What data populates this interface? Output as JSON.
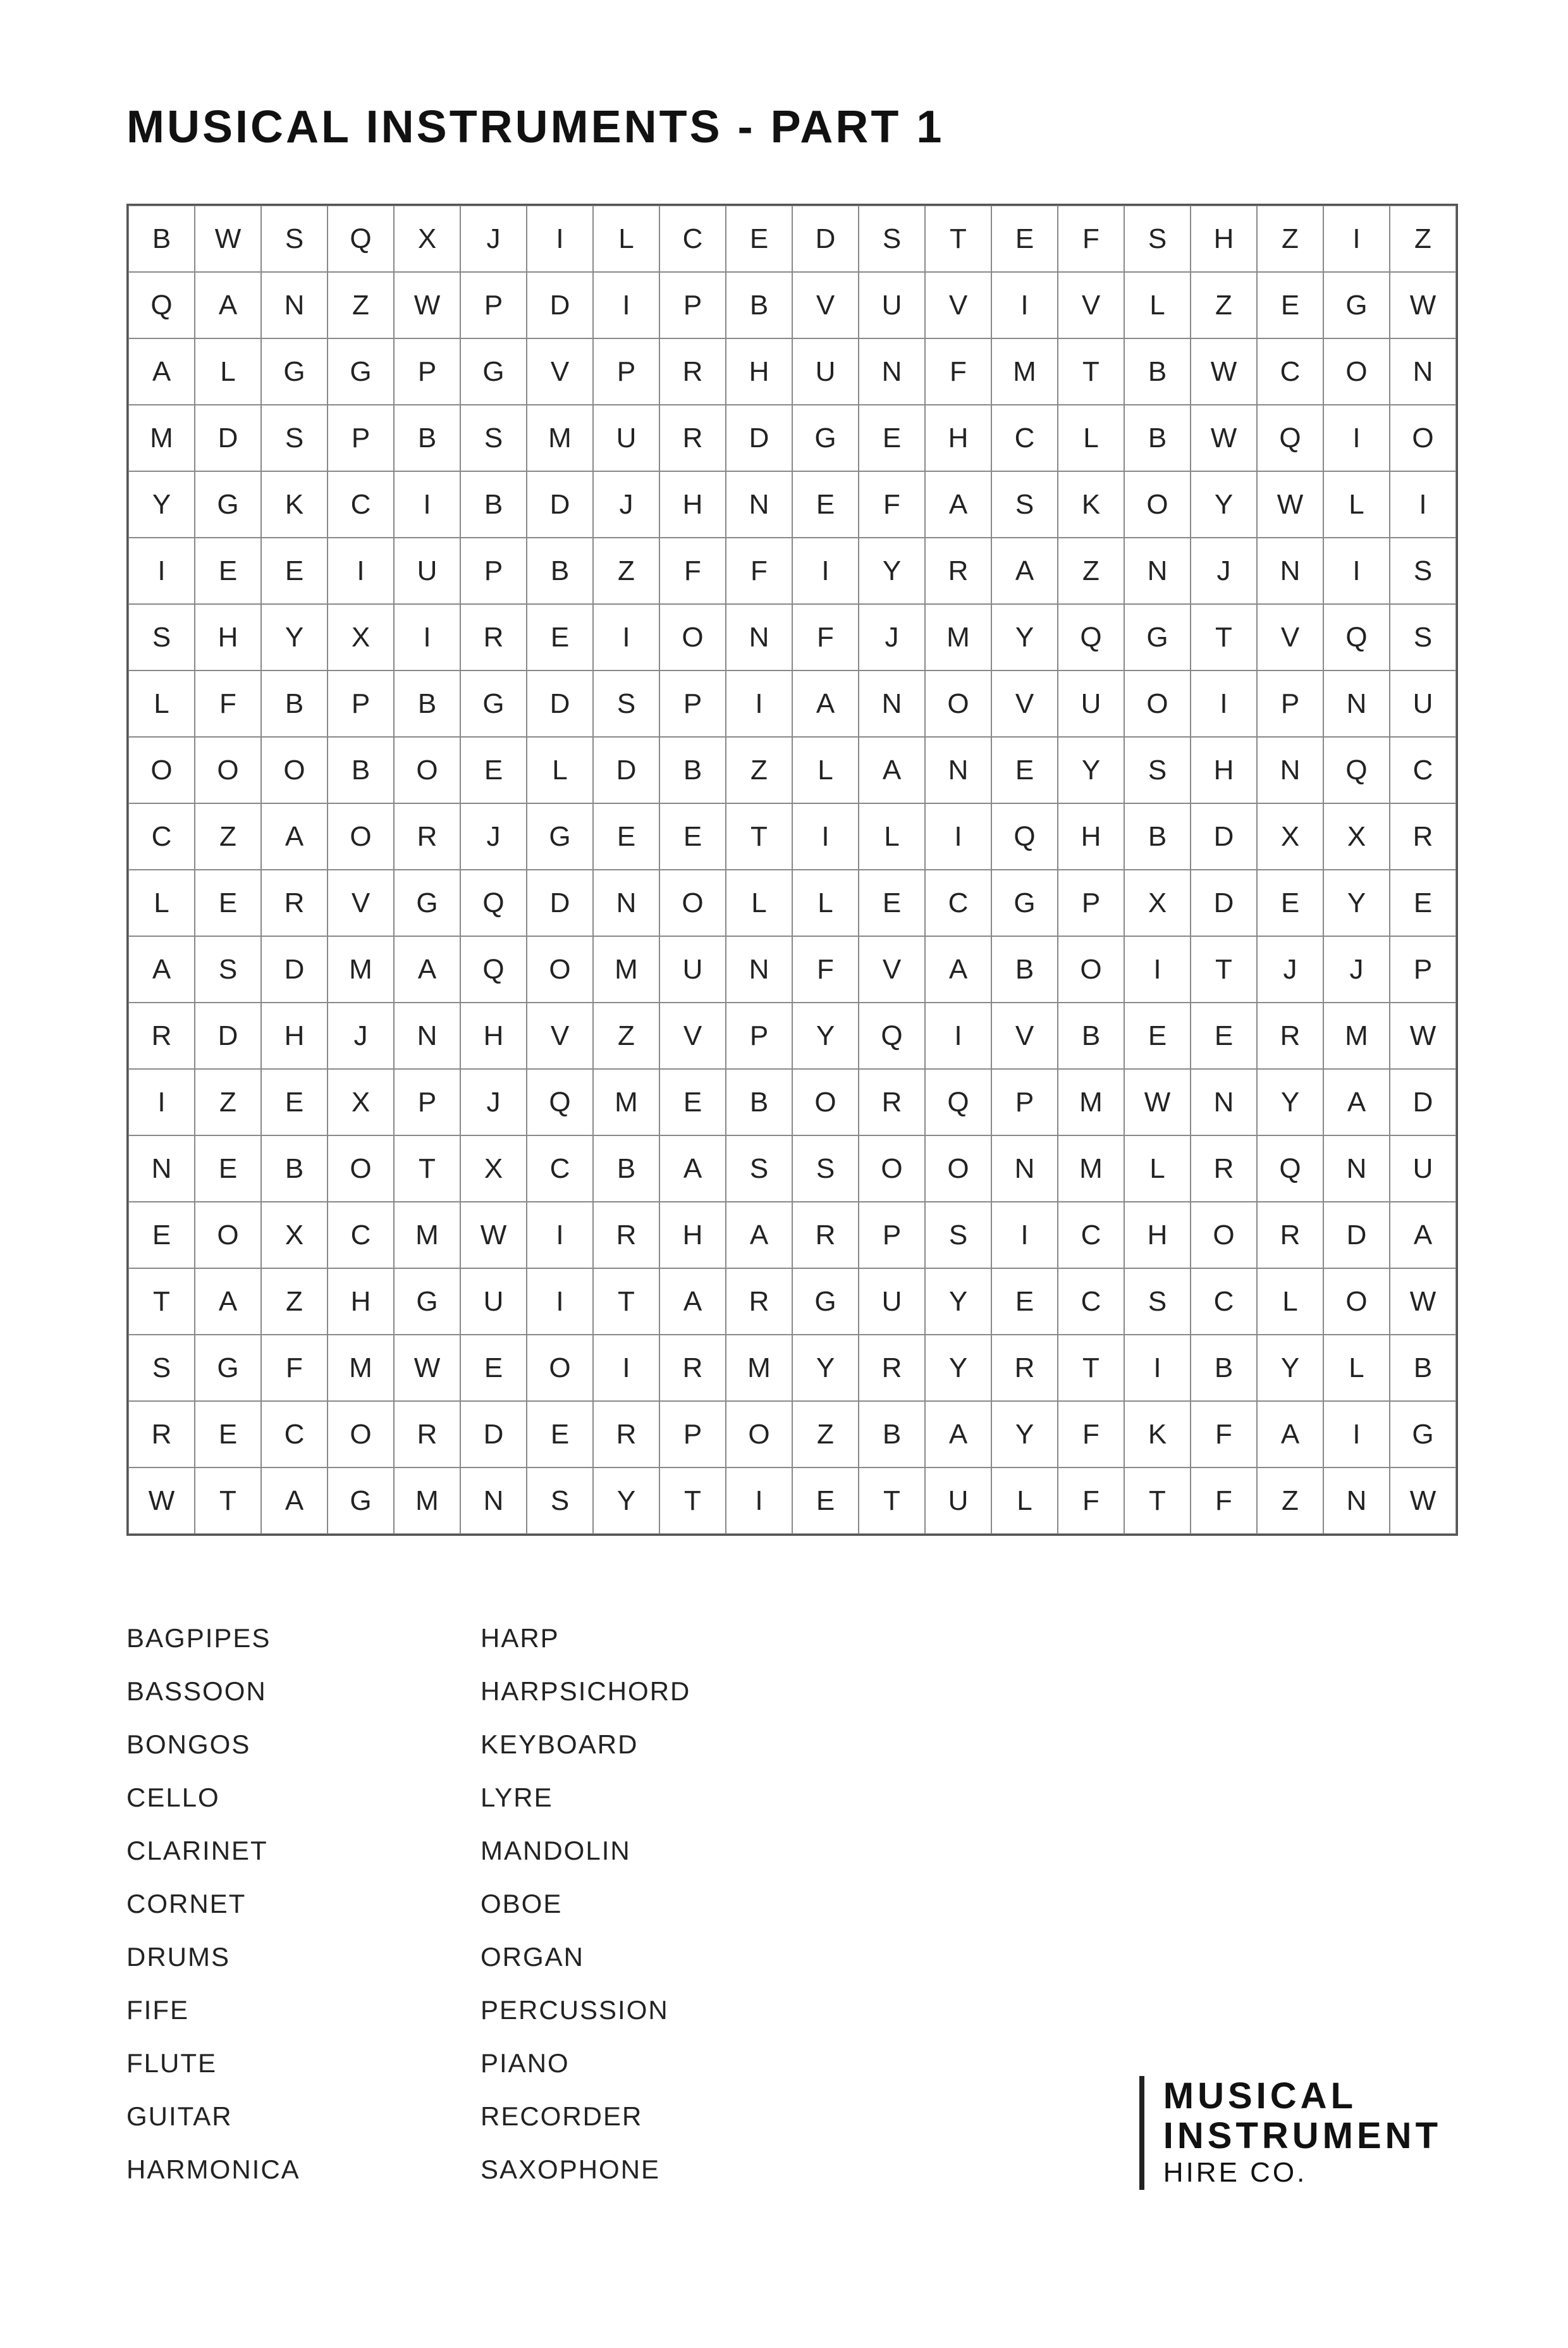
{
  "title": "MUSICAL INSTRUMENTS - PART 1",
  "grid": [
    [
      "B",
      "W",
      "S",
      "Q",
      "X",
      "J",
      "I",
      "L",
      "C",
      "E",
      "D",
      "S",
      "T",
      "E",
      "F",
      "S",
      "H",
      "Z",
      "I",
      "Z"
    ],
    [
      "Q",
      "A",
      "N",
      "Z",
      "W",
      "P",
      "D",
      "I",
      "P",
      "B",
      "V",
      "U",
      "V",
      "I",
      "V",
      "L",
      "Z",
      "E",
      "G",
      "W"
    ],
    [
      "A",
      "L",
      "G",
      "G",
      "P",
      "G",
      "V",
      "P",
      "R",
      "H",
      "U",
      "N",
      "F",
      "M",
      "T",
      "B",
      "W",
      "C",
      "O",
      "N"
    ],
    [
      "M",
      "D",
      "S",
      "P",
      "B",
      "S",
      "M",
      "U",
      "R",
      "D",
      "G",
      "E",
      "H",
      "C",
      "L",
      "B",
      "W",
      "Q",
      "I",
      "O"
    ],
    [
      "Y",
      "G",
      "K",
      "C",
      "I",
      "B",
      "D",
      "J",
      "H",
      "N",
      "E",
      "F",
      "A",
      "S",
      "K",
      "O",
      "Y",
      "W",
      "L",
      "I"
    ],
    [
      "I",
      "E",
      "E",
      "I",
      "U",
      "P",
      "B",
      "Z",
      "F",
      "F",
      "I",
      "Y",
      "R",
      "A",
      "Z",
      "N",
      "J",
      "N",
      "I",
      "S"
    ],
    [
      "S",
      "H",
      "Y",
      "X",
      "I",
      "R",
      "E",
      "I",
      "O",
      "N",
      "F",
      "J",
      "M",
      "Y",
      "Q",
      "G",
      "T",
      "V",
      "Q",
      "S"
    ],
    [
      "L",
      "F",
      "B",
      "P",
      "B",
      "G",
      "D",
      "S",
      "P",
      "I",
      "A",
      "N",
      "O",
      "V",
      "U",
      "O",
      "I",
      "P",
      "N",
      "U"
    ],
    [
      "O",
      "O",
      "O",
      "B",
      "O",
      "E",
      "L",
      "D",
      "B",
      "Z",
      "L",
      "A",
      "N",
      "E",
      "Y",
      "S",
      "H",
      "N",
      "Q",
      "C"
    ],
    [
      "C",
      "Z",
      "A",
      "O",
      "R",
      "J",
      "G",
      "E",
      "E",
      "T",
      "I",
      "L",
      "I",
      "Q",
      "H",
      "B",
      "D",
      "X",
      "X",
      "R"
    ],
    [
      "L",
      "E",
      "R",
      "V",
      "G",
      "Q",
      "D",
      "N",
      "O",
      "L",
      "L",
      "E",
      "C",
      "G",
      "P",
      "X",
      "D",
      "E",
      "Y",
      "E"
    ],
    [
      "A",
      "S",
      "D",
      "M",
      "A",
      "Q",
      "O",
      "M",
      "U",
      "N",
      "F",
      "V",
      "A",
      "B",
      "O",
      "I",
      "T",
      "J",
      "J",
      "P"
    ],
    [
      "R",
      "D",
      "H",
      "J",
      "N",
      "H",
      "V",
      "Z",
      "V",
      "P",
      "Y",
      "Q",
      "I",
      "V",
      "B",
      "E",
      "E",
      "R",
      "M",
      "W"
    ],
    [
      "I",
      "Z",
      "E",
      "X",
      "P",
      "J",
      "Q",
      "M",
      "E",
      "B",
      "O",
      "R",
      "Q",
      "P",
      "M",
      "W",
      "N",
      "Y",
      "A",
      "D"
    ],
    [
      "N",
      "E",
      "B",
      "O",
      "T",
      "X",
      "C",
      "B",
      "A",
      "S",
      "S",
      "O",
      "O",
      "N",
      "M",
      "L",
      "R",
      "Q",
      "N",
      "U"
    ],
    [
      "E",
      "O",
      "X",
      "C",
      "M",
      "W",
      "I",
      "R",
      "H",
      "A",
      "R",
      "P",
      "S",
      "I",
      "C",
      "H",
      "O",
      "R",
      "D",
      "A"
    ],
    [
      "T",
      "A",
      "Z",
      "H",
      "G",
      "U",
      "I",
      "T",
      "A",
      "R",
      "G",
      "U",
      "Y",
      "E",
      "C",
      "S",
      "C",
      "L",
      "O",
      "W"
    ],
    [
      "S",
      "G",
      "F",
      "M",
      "W",
      "E",
      "O",
      "I",
      "R",
      "M",
      "Y",
      "R",
      "Y",
      "R",
      "T",
      "I",
      "B",
      "Y",
      "L",
      "B"
    ],
    [
      "R",
      "E",
      "C",
      "O",
      "R",
      "D",
      "E",
      "R",
      "P",
      "O",
      "Z",
      "B",
      "A",
      "Y",
      "F",
      "K",
      "F",
      "A",
      "I",
      "G"
    ],
    [
      "W",
      "T",
      "A",
      "G",
      "M",
      "N",
      "S",
      "Y",
      "T",
      "I",
      "E",
      "T",
      "U",
      "L",
      "F",
      "T",
      "F",
      "Z",
      "N",
      "W"
    ]
  ],
  "word_list_col1": [
    "BAGPIPES",
    "BASSOON",
    "BONGOS",
    "CELLO",
    "CLARINET",
    "CORNET",
    "DRUMS",
    "FIFE",
    "FLUTE",
    "GUITAR",
    "HARMONICA"
  ],
  "word_list_col2": [
    "HARP",
    "HARPSICHORD",
    "KEYBOARD",
    "LYRE",
    "MANDOLIN",
    "OBOE",
    "ORGAN",
    "PERCUSSION",
    "PIANO",
    "RECORDER",
    "SAXOPHONE"
  ],
  "logo": {
    "line1": "MUSICAL",
    "line2": "INSTRUMENT",
    "line3": "HIRE CO."
  }
}
